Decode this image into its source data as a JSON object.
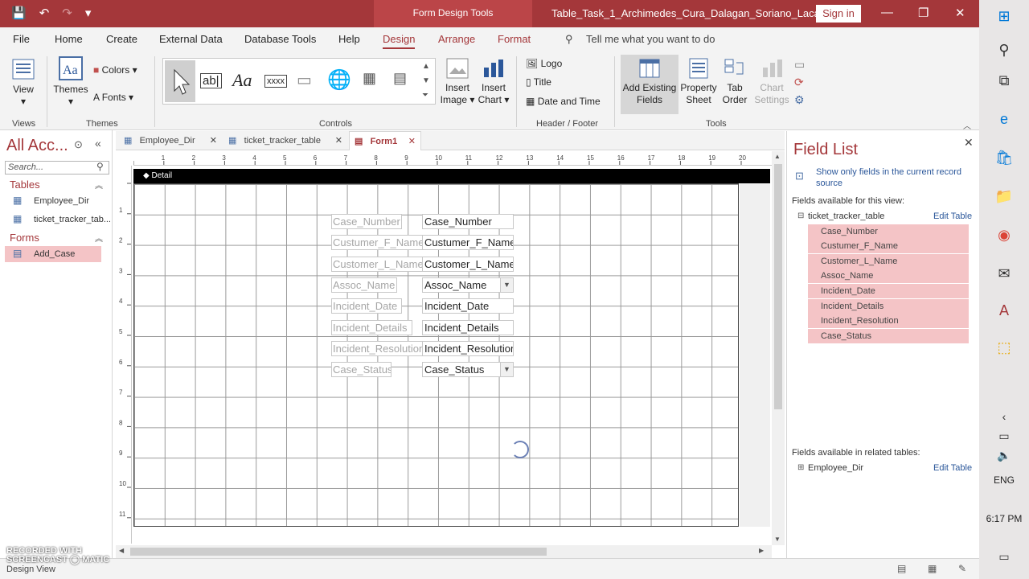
{
  "titlebar": {
    "context_tools": "Form Design Tools",
    "doc_title": "Table_Task_1_Archimedes_Cura_Dalagan_Soriano_Lacatan :...",
    "signin": "Sign in",
    "minimize": "—",
    "restore": "❐",
    "close": "✕"
  },
  "ribbon_tabs": {
    "file": "File",
    "home": "Home",
    "create": "Create",
    "external": "External Data",
    "dbtools": "Database Tools",
    "help": "Help",
    "design": "Design",
    "arrange": "Arrange",
    "format": "Format",
    "tell": "Tell me what you want to do"
  },
  "ribbon": {
    "view": "View",
    "themes": "Themes",
    "colors": "Colors",
    "fonts": "Fonts",
    "insert_image_1": "Insert",
    "insert_image_2": "Image",
    "insert_chart_1": "Insert",
    "insert_chart_2": "Chart",
    "logo": "Logo",
    "title": "Title",
    "date_time": "Date and Time",
    "add_fields_1": "Add Existing",
    "add_fields_2": "Fields",
    "prop_1": "Property",
    "prop_2": "Sheet",
    "tab_1": "Tab",
    "tab_2": "Order",
    "chart_settings_1": "Chart",
    "chart_settings_2": "Settings",
    "group_views": "Views",
    "group_themes": "Themes",
    "group_controls": "Controls",
    "group_header": "Header / Footer",
    "group_tools": "Tools",
    "gallery_textbox": "ab|",
    "gallery_label": "Aa",
    "gallery_button": "xxxx"
  },
  "nav": {
    "title": "All Acc...",
    "search_placeholder": "Search...",
    "tables_header": "Tables",
    "tables": [
      "Employee_Dir",
      "ticket_tracker_tab..."
    ],
    "forms_header": "Forms",
    "forms": [
      "Add_Case"
    ]
  },
  "doc_tabs": [
    "Employee_Dir",
    "ticket_tracker_table",
    "Form1"
  ],
  "design": {
    "section": "Detail",
    "ruler_h": [
      "1",
      "2",
      "3",
      "4",
      "5",
      "6",
      "7",
      "8",
      "9",
      "10",
      "11",
      "12",
      "13",
      "14",
      "15",
      "16",
      "17",
      "18",
      "19",
      "20"
    ],
    "ruler_v": [
      "1",
      "2",
      "3",
      "4",
      "5",
      "6",
      "7",
      "8",
      "9",
      "10",
      "11"
    ],
    "labels": [
      "Case_Number",
      "Custumer_F_Name",
      "Customer_L_Name",
      "Assoc_Name",
      "Incident_Date",
      "Incident_Details",
      "Incident_Resolution",
      "Case_Status"
    ],
    "values": [
      "Case_Number",
      "Custumer_F_Name",
      "Customer_L_Name",
      "Assoc_Name",
      "Incident_Date",
      "Incident_Details",
      "Incident_Resolution",
      "Case_Status"
    ]
  },
  "field_list": {
    "title": "Field List",
    "show_only": "Show only fields in the current record source",
    "available_label": "Fields available for this view:",
    "table": "ticket_tracker_table",
    "edit_table": "Edit Table",
    "fields": [
      "Case_Number",
      "Custumer_F_Name",
      "Customer_L_Name",
      "Assoc_Name",
      "Incident_Date",
      "Incident_Details",
      "Incident_Resolution",
      "Case_Status"
    ],
    "related_label": "Fields available in related tables:",
    "related_table": "Employee_Dir",
    "related_edit": "Edit Table"
  },
  "status": {
    "mode": "Design View",
    "watermark_1": "RECORDED WITH",
    "watermark_2": "SCREENCAST ◯ MATIC"
  },
  "taskbar": {
    "lang": "ENG",
    "time": "6:17 PM"
  }
}
